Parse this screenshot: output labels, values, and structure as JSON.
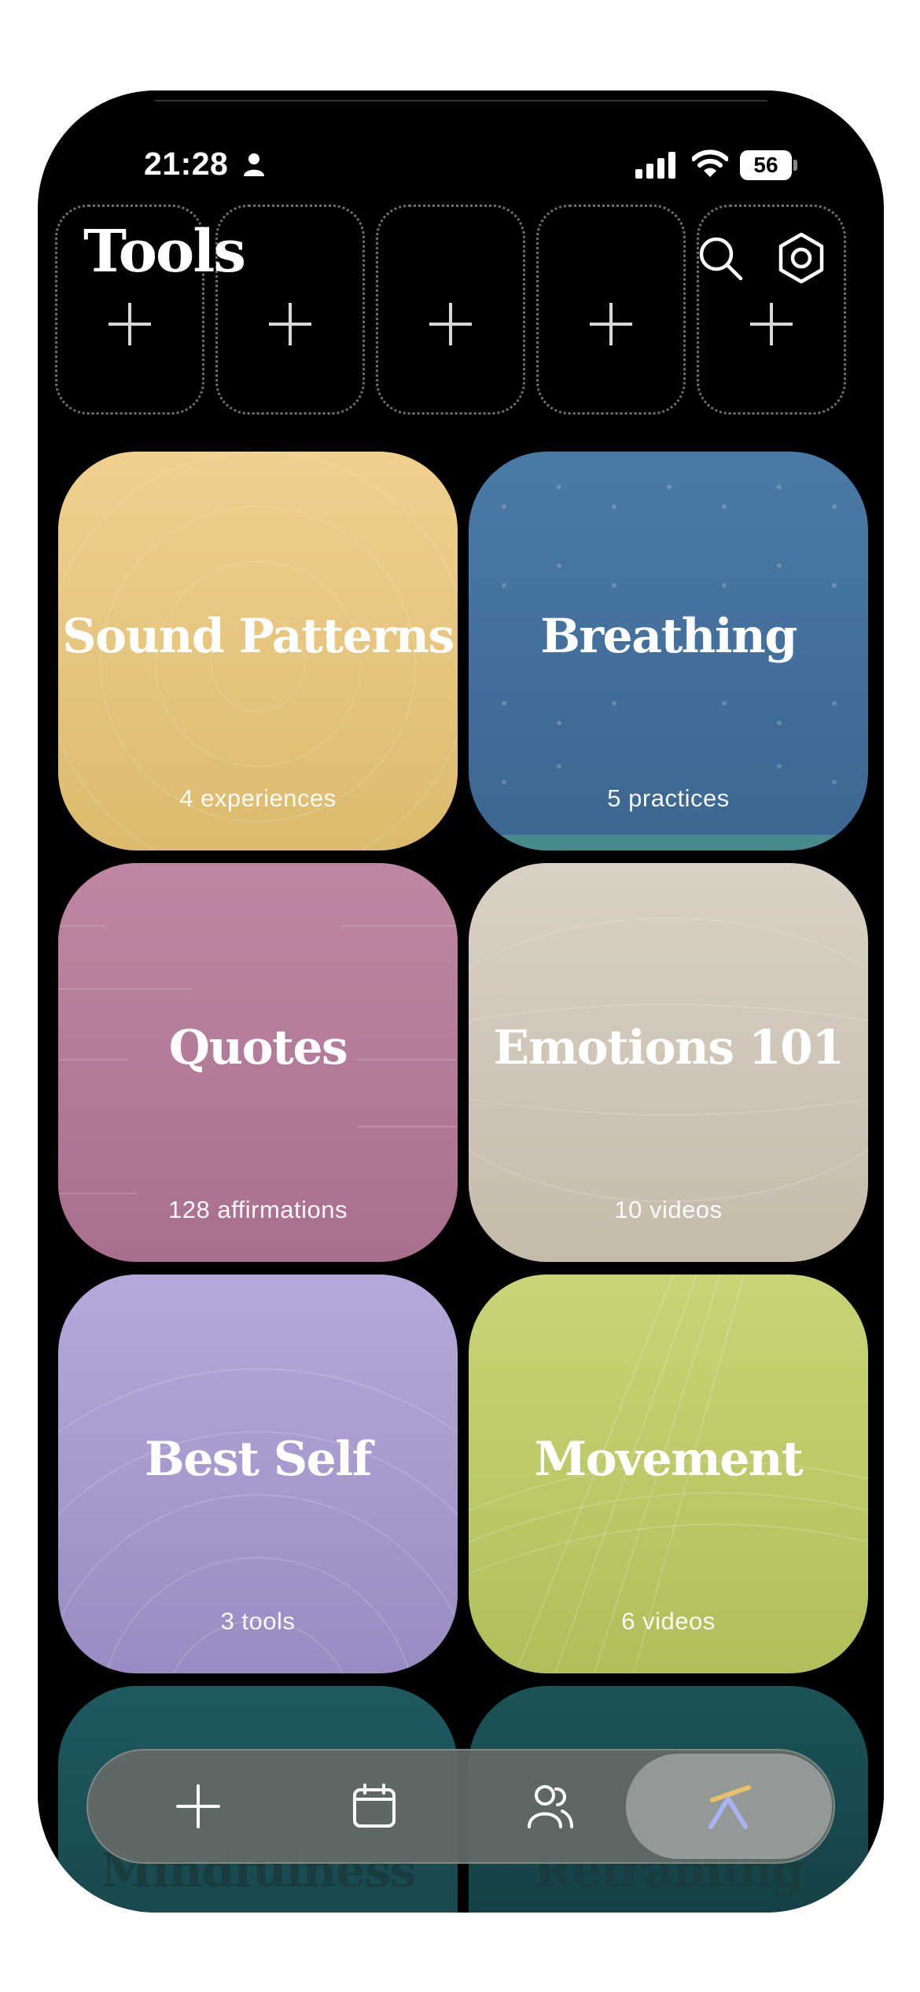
{
  "status_bar": {
    "time": "21:28",
    "battery": "56"
  },
  "header": {
    "title": "Tools"
  },
  "favorite_slots": [
    {
      "icon": "plus-icon"
    },
    {
      "icon": "plus-icon"
    },
    {
      "icon": "plus-icon"
    },
    {
      "icon": "plus-icon"
    },
    {
      "icon": "plus-icon"
    }
  ],
  "cards": [
    {
      "title": "Sound Patterns",
      "subtitle": "4 experiences",
      "color": "#e8c67e"
    },
    {
      "title": "Breathing",
      "subtitle": "5 practices",
      "color": "#44719b"
    },
    {
      "title": "Quotes",
      "subtitle": "128 affirmations",
      "color": "#b47c99"
    },
    {
      "title": "Emotions 101",
      "subtitle": "10 videos",
      "color": "#cfc6b8"
    },
    {
      "title": "Best Self",
      "subtitle": "3 tools",
      "color": "#a99bd0"
    },
    {
      "title": "Movement",
      "subtitle": "6 videos",
      "color": "#c0ca6a"
    },
    {
      "title": "Mindfulness",
      "subtitle": "",
      "color": "#1b4f52"
    },
    {
      "title": "Reframing",
      "subtitle": "",
      "color": "#174a4d"
    }
  ],
  "tab_bar": {
    "tabs": [
      {
        "icon": "plus-icon",
        "active": false
      },
      {
        "icon": "calendar-icon",
        "active": false
      },
      {
        "icon": "people-icon",
        "active": false
      },
      {
        "icon": "tools-icon",
        "active": true
      }
    ]
  }
}
